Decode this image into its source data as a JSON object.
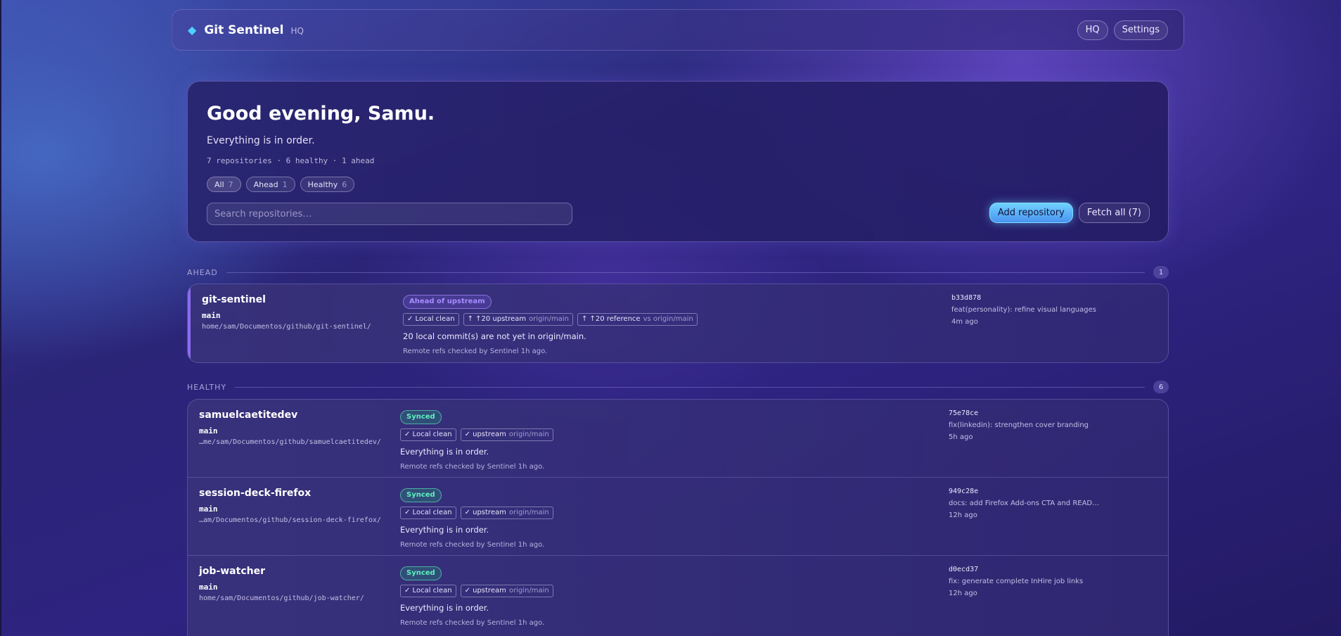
{
  "topbar": {
    "brand_icon": "◆",
    "brand_name": "Git Sentinel",
    "brand_tag": "HQ",
    "hq_label": "HQ",
    "settings_label": "Settings"
  },
  "hero": {
    "title": "Good evening, Samu.",
    "subtitle": "Everything is in order.",
    "stats": "7 repositories · 6 healthy · 1 ahead",
    "filters": [
      {
        "label": "All",
        "count": "7"
      },
      {
        "label": "Ahead",
        "count": "1"
      },
      {
        "label": "Healthy",
        "count": "6"
      }
    ],
    "search_placeholder": "Search repositories…",
    "add_label": "Add repository",
    "fetch_label": "Fetch all (7)"
  },
  "sections": {
    "ahead": {
      "label": "AHEAD",
      "count": "1",
      "repos": [
        {
          "name": "git-sentinel",
          "branch": "main",
          "path": "home/sam/Documentos/github/git-sentinel/",
          "status": "Ahead of upstream",
          "chip1": "✓ Local clean",
          "chip2_main": "↑ ↑20 upstream",
          "chip2_muted": "origin/main",
          "chip3_main": "↑ ↑20 reference",
          "chip3_muted": "vs origin/main",
          "message": "20 local commit(s) are not yet in origin/main.",
          "checked": "Remote refs checked by Sentinel 1h ago.",
          "hash": "b33d878",
          "commit": "feat(personality): refine visual languages",
          "time": "4m ago"
        }
      ]
    },
    "healthy": {
      "label": "HEALTHY",
      "count": "6",
      "repos": [
        {
          "name": "samuelcaetitedev",
          "branch": "main",
          "path": "…me/sam/Documentos/github/samuelcaetitedev/",
          "status": "Synced",
          "chip1": "✓ Local clean",
          "chip2_main": "✓ upstream",
          "chip2_muted": "origin/main",
          "message": "Everything is in order.",
          "checked": "Remote refs checked by Sentinel 1h ago.",
          "hash": "75e78ce",
          "commit": "fix(linkedin): strengthen cover branding",
          "time": "5h ago"
        },
        {
          "name": "session-deck-firefox",
          "branch": "main",
          "path": "…am/Documentos/github/session-deck-firefox/",
          "status": "Synced",
          "chip1": "✓ Local clean",
          "chip2_main": "✓ upstream",
          "chip2_muted": "origin/main",
          "message": "Everything is in order.",
          "checked": "Remote refs checked by Sentinel 1h ago.",
          "hash": "949c28e",
          "commit": "docs: add Firefox Add-ons CTA and READ…",
          "time": "12h ago"
        },
        {
          "name": "job-watcher",
          "branch": "main",
          "path": "home/sam/Documentos/github/job-watcher/",
          "status": "Synced",
          "chip1": "✓ Local clean",
          "chip2_main": "✓ upstream",
          "chip2_muted": "origin/main",
          "message": "Everything is in order.",
          "checked": "Remote refs checked by Sentinel 1h ago.",
          "hash": "d0ecd37",
          "commit": "fix: generate complete InHire job links",
          "time": "12h ago"
        }
      ]
    }
  },
  "colors": {
    "accent_cyan": "#4fd0ff",
    "ahead_purple": "#a88cff",
    "synced_green": "#5ff0c0"
  }
}
